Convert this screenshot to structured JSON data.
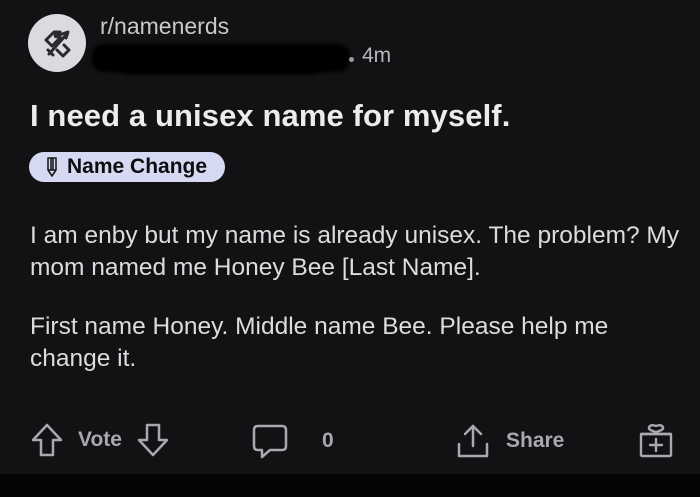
{
  "post": {
    "subreddit": "r/namenerds",
    "time": "4m",
    "title": "I need a unisex name for myself.",
    "flair": {
      "icon": "pencil-icon",
      "label": "Name Change",
      "bg_color": "#d6d9f2"
    },
    "body": [
      "I am enby but my name is already unisex. The problem? My mom named me Honey Bee [Last Name].",
      "First name Honey. Middle name Bee. Please help me change it."
    ]
  },
  "actions": {
    "vote_label": "Vote",
    "comment_count": "0",
    "share_label": "Share"
  }
}
